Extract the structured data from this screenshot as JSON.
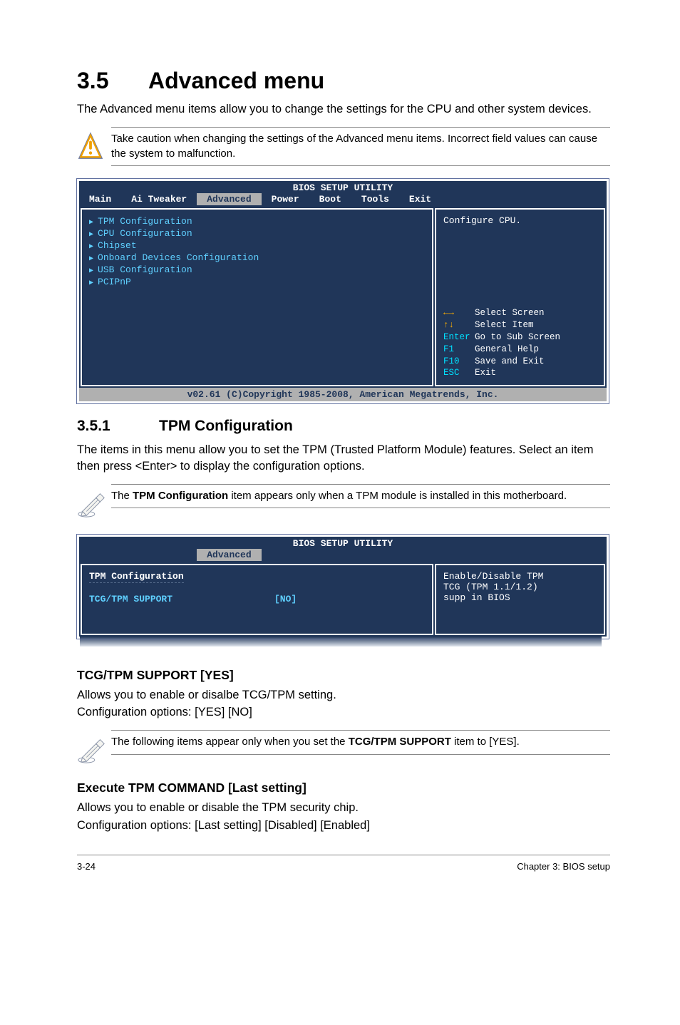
{
  "section": {
    "number": "3.5",
    "title": "Advanced menu",
    "intro": "The Advanced menu items allow you to change the settings for the CPU and other system devices."
  },
  "caution_note": "Take caution when changing the settings of the Advanced menu items. Incorrect field values can cause the system to malfunction.",
  "bios1": {
    "title": "BIOS SETUP UTILITY",
    "tabs": [
      "Main",
      "Ai Tweaker",
      "Advanced",
      "Power",
      "Boot",
      "Tools",
      "Exit"
    ],
    "active_tab": "Advanced",
    "items": [
      "TPM Configuration",
      "CPU Configuration",
      "Chipset",
      "Onboard Devices Configuration",
      "USB Configuration",
      "PCIPnP"
    ],
    "right_top": "Configure CPU.",
    "help": [
      {
        "sym": "←→",
        "lbl": "Select Screen"
      },
      {
        "sym": "↑↓",
        "lbl": "Select Item"
      },
      {
        "sym": "Enter",
        "lbl": "Go to Sub Screen"
      },
      {
        "sym": "F1",
        "lbl": "General Help"
      },
      {
        "sym": "F10",
        "lbl": "Save and Exit"
      },
      {
        "sym": "ESC",
        "lbl": "Exit"
      }
    ],
    "footer": "v02.61 (C)Copyright 1985-2008, American Megatrends, Inc."
  },
  "sub351": {
    "number": "3.5.1",
    "title": "TPM Configuration",
    "desc": "The items in this menu allow you to set the TPM (Trusted Platform Module) features. Select an item then press <Enter> to display the configuration options."
  },
  "tpm_note_prefix": "The ",
  "tpm_note_bold": "TPM Configuration",
  "tpm_note_suffix": " item appears only when a TPM module is installed in this motherboard.",
  "bios2": {
    "title": "BIOS SETUP UTILITY",
    "active_tab": "Advanced",
    "heading": "TPM Configuration",
    "row_label": "TCG/TPM SUPPORT",
    "row_value": "[NO]",
    "right_line1": "Enable/Disable TPM",
    "right_line2": "TCG (TPM 1.1/1.2)",
    "right_line3": "supp in BIOS"
  },
  "tcg": {
    "heading": "TCG/TPM SUPPORT [YES]",
    "line1": "Allows you to enable or disalbe TCG/TPM setting.",
    "line2": "Configuration options: [YES] [NO]"
  },
  "tcg_note_prefix": "The following items appear only when you set the ",
  "tcg_note_bold": "TCG/TPM SUPPORT",
  "tcg_note_suffix": " item to [YES].",
  "execcmd": {
    "heading": "Execute TPM COMMAND [Last setting]",
    "line1": "Allows you to enable or disable the TPM security chip.",
    "line2": "Configuration options: [Last setting] [Disabled] [Enabled]"
  },
  "footer": {
    "left": "3-24",
    "right": "Chapter 3: BIOS setup"
  }
}
